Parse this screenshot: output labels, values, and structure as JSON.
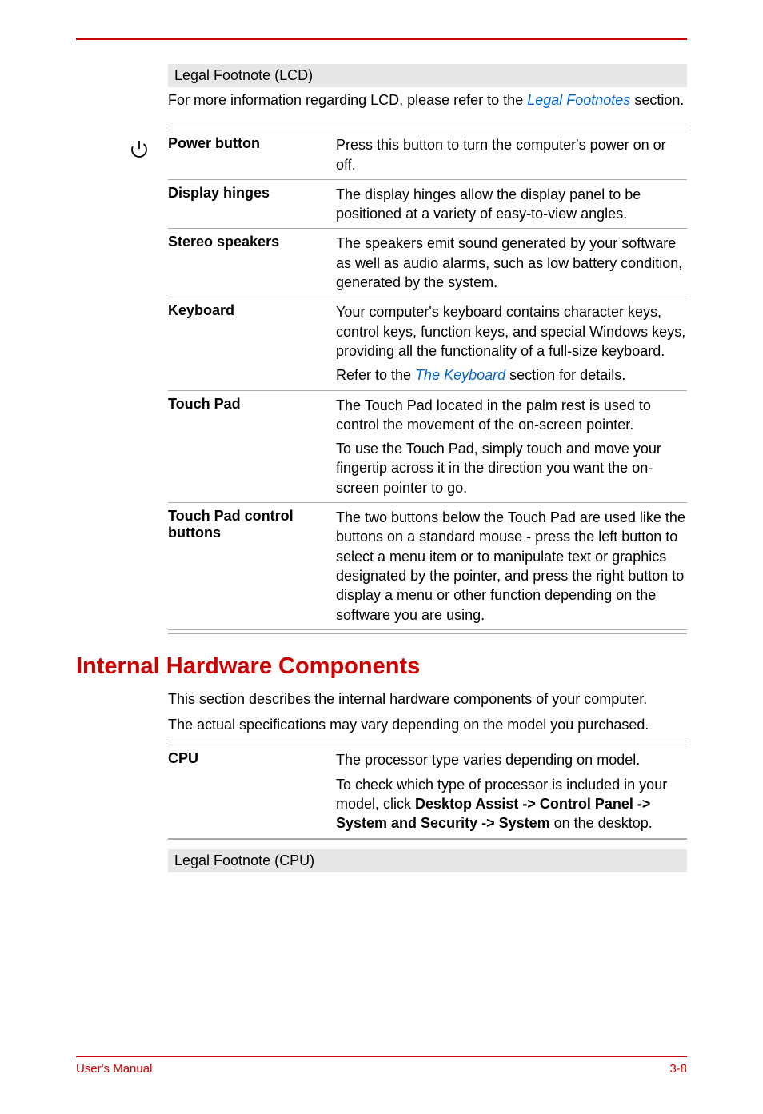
{
  "legal_lcd": {
    "title": "Legal Footnote (LCD)",
    "prefix": "For more information regarding LCD, please refer to the ",
    "link": "Legal Footnotes",
    "suffix": " section."
  },
  "features": [
    {
      "label": "Power button",
      "paras": [
        "Press this button to turn the computer's power on or off."
      ]
    },
    {
      "label": "Display hinges",
      "paras": [
        "The display hinges allow the display panel to be positioned at a variety of easy-to-view angles."
      ]
    },
    {
      "label": "Stereo speakers",
      "paras": [
        "The speakers emit sound generated by your software as well as audio alarms, such as low battery condition, generated by the system."
      ]
    },
    {
      "label": "Keyboard",
      "paras": [
        "Your computer's keyboard contains character keys, control keys, function keys, and special Windows keys, providing all the functionality of a full-size keyboard."
      ],
      "link_prefix": "Refer to the ",
      "link_text": "The Keyboard",
      "link_suffix": " section for details."
    },
    {
      "label": "Touch Pad",
      "paras": [
        "The Touch Pad located in the palm rest is used to control the movement of the on-screen pointer.",
        "To use the Touch Pad, simply touch and move your fingertip across it in the direction you want the on-screen pointer to go."
      ]
    },
    {
      "label": "Touch Pad control buttons",
      "paras": [
        "The two buttons below the Touch Pad are used like the buttons on a standard mouse - press the left button to select a menu item or to manipulate text or graphics designated by the pointer, and press the right button to display a menu or other function depending on the software you are using."
      ]
    }
  ],
  "section_heading": "Internal Hardware Components",
  "intro": [
    "This section describes the internal hardware components of your computer.",
    "The actual specifications may vary depending on the model you purchased."
  ],
  "cpu": {
    "label": "CPU",
    "p1": "The processor type varies depending on model.",
    "p2_prefix": "To check which type of processor is included in your model, click ",
    "p2_bold": "Desktop Assist -> Control Panel -> System and Security -> System",
    "p2_suffix": " on the desktop."
  },
  "legal_cpu": "Legal Footnote (CPU)",
  "footer": {
    "left": "User's Manual",
    "right": "3-8"
  }
}
